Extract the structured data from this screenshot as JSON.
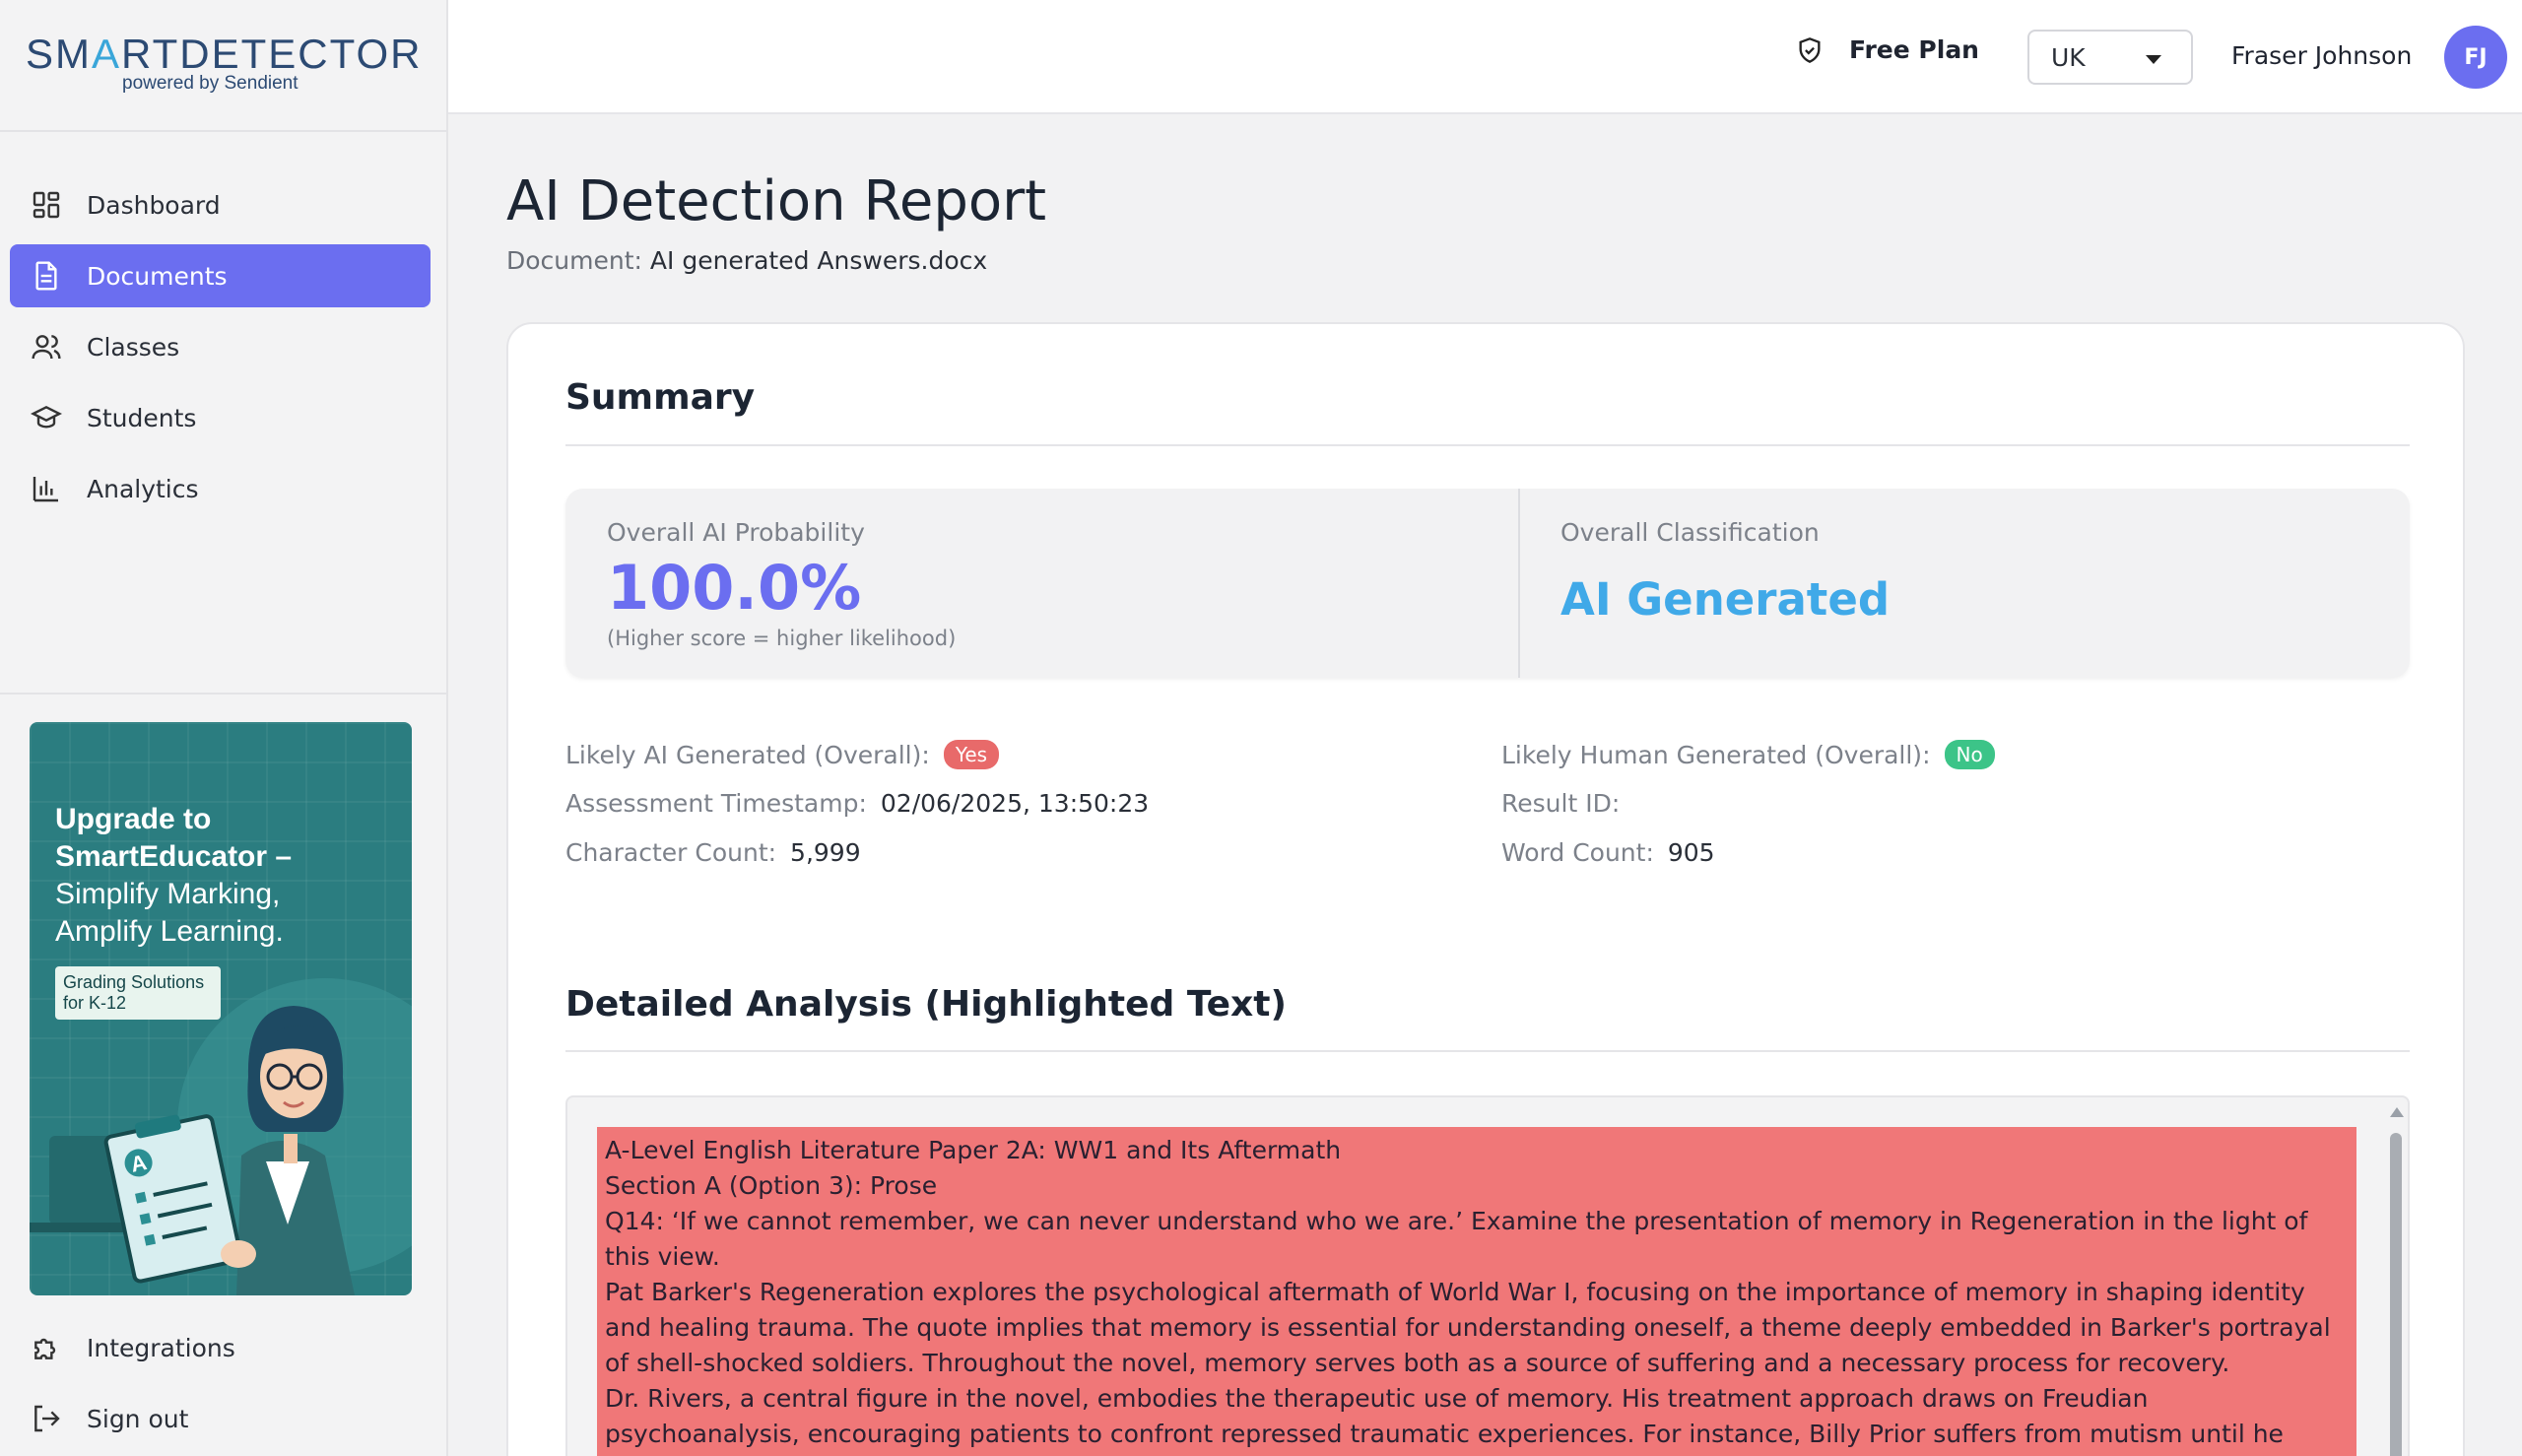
{
  "brand": {
    "name_part1": "SM",
    "name_part2": "A",
    "name_part3": "RTDETECTOR",
    "subtitle": "powered by Sendient"
  },
  "sidebar": {
    "items": [
      {
        "label": "Dashboard",
        "icon": "dashboard-icon",
        "active": false
      },
      {
        "label": "Documents",
        "icon": "document-icon",
        "active": true
      },
      {
        "label": "Classes",
        "icon": "users-icon",
        "active": false
      },
      {
        "label": "Students",
        "icon": "graduation-cap-icon",
        "active": false
      },
      {
        "label": "Analytics",
        "icon": "bar-chart-icon",
        "active": false
      }
    ],
    "bottom_items": [
      {
        "label": "Integrations",
        "icon": "puzzle-icon"
      },
      {
        "label": "Sign out",
        "icon": "sign-out-icon"
      }
    ],
    "promo": {
      "line1": "Upgrade to",
      "line2": "SmartEducator –",
      "line3": "Simplify Marking, Amplify Learning.",
      "badge": "Grading Solutions for K-12",
      "clipboard_letter": "A"
    }
  },
  "topbar": {
    "plan": "Free Plan",
    "region": "UK",
    "user_name": "Fraser Johnson",
    "user_initials": "FJ"
  },
  "page": {
    "title": "AI Detection Report",
    "document_label": "Document:",
    "document_name": "AI generated Answers.docx"
  },
  "summary": {
    "title": "Summary",
    "probability_label": "Overall AI Probability",
    "probability_value": "100.0%",
    "probability_note": "(Higher score = higher likelihood)",
    "classification_label": "Overall Classification",
    "classification_value": "AI Generated"
  },
  "meta": {
    "likely_ai_label": "Likely AI Generated (Overall):",
    "likely_ai_value": "Yes",
    "likely_human_label": "Likely Human Generated (Overall):",
    "likely_human_value": "No",
    "timestamp_label": "Assessment Timestamp:",
    "timestamp_value": "02/06/2025, 13:50:23",
    "result_id_label": "Result ID:",
    "char_count_label": "Character Count:",
    "char_count_value": "5,999",
    "word_count_label": "Word Count:",
    "word_count_value": "905"
  },
  "analysis": {
    "title": "Detailed Analysis (Highlighted Text)",
    "lines": [
      "A-Level English Literature Paper 2A: WW1 and Its Aftermath",
      "Section A (Option 3): Prose",
      "Q14: ‘If we cannot remember, we can never understand who we are.’ Examine the presentation of memory in Regeneration in the light of this view.",
      "Pat Barker's Regeneration explores the psychological aftermath of World War I, focusing on the importance of memory in shaping identity and healing trauma. The quote implies that memory is essential for understanding oneself, a theme deeply embedded in Barker's portrayal of shell-shocked soldiers. Throughout the novel, memory serves both as a source of suffering and a necessary process for recovery.",
      "Dr. Rivers, a central figure in the novel, embodies the therapeutic use of memory. His treatment approach draws on Freudian psychoanalysis, encouraging patients to confront repressed traumatic experiences. For instance, Billy Prior suffers from mutism until he begins to recall the"
    ],
    "highlight_color": "#f07778"
  },
  "colors": {
    "accent": "#6b6ef0",
    "classification": "#40a9e8",
    "yes": "#e86a6a",
    "no": "#3cc488"
  }
}
